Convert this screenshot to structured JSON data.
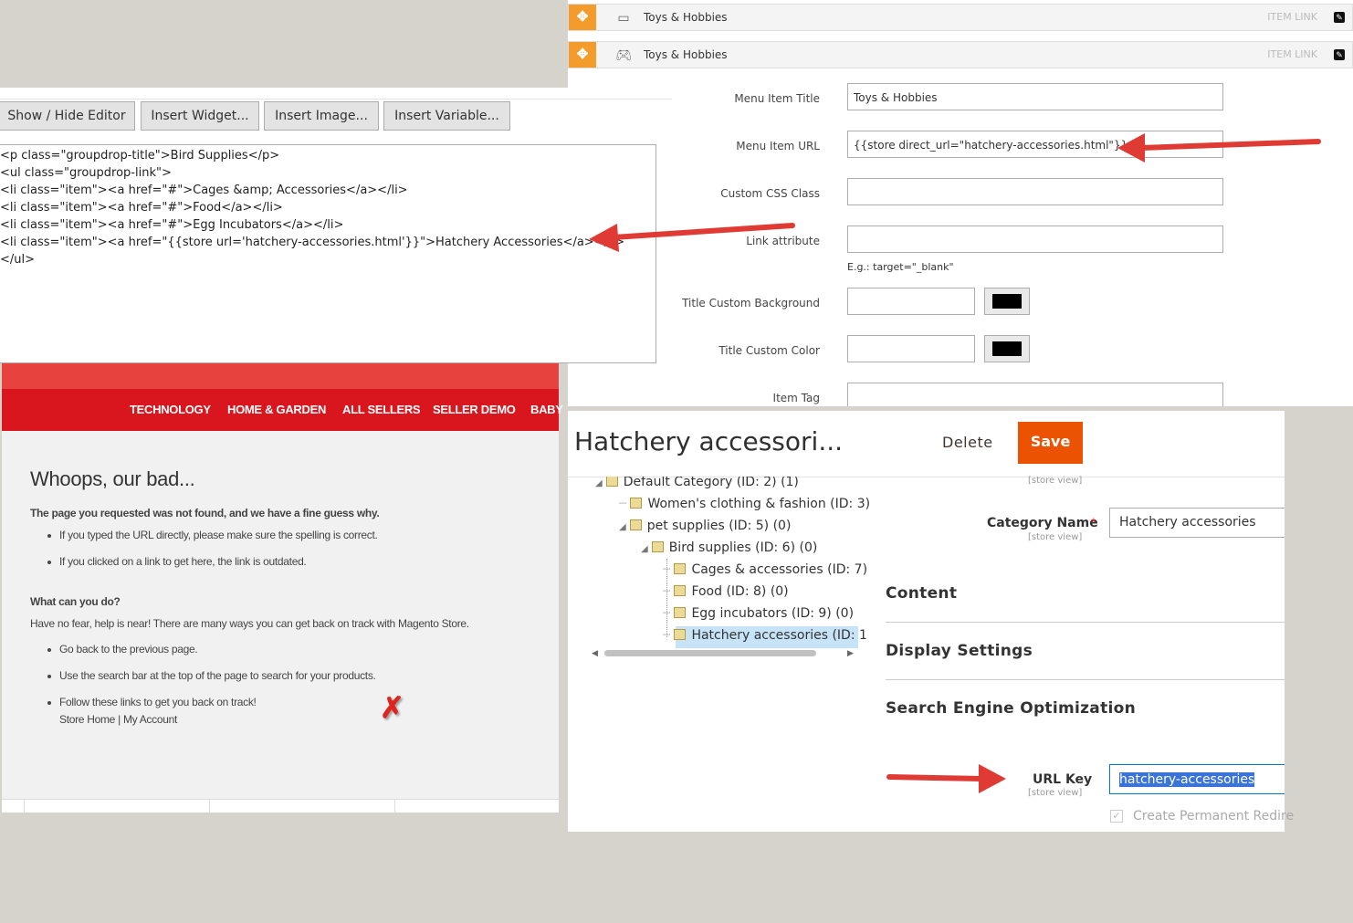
{
  "menu_panel": {
    "rows": [
      {
        "label": "Toys & Hobbies",
        "type": "ITEM LINK",
        "icon": "briefcase-icon"
      },
      {
        "label": "Toys & Hobbies",
        "type": "ITEM LINK",
        "icon": "gamepad-icon"
      }
    ],
    "fields": {
      "title_label": "Menu Item Title",
      "title_value": "Toys & Hobbies",
      "url_label": "Menu Item URL",
      "url_value": "{{store direct_url=\"hatchery-accessories.html\"}}",
      "css_label": "Custom CSS Class",
      "link_attr_label": "Link attribute",
      "link_attr_note": "E.g.: target=\"_blank\"",
      "title_bg_label": "Title Custom Background",
      "title_color_label": "Title Custom Color",
      "item_tag_label": "Item Tag"
    },
    "swatch_color": "#000000"
  },
  "editor": {
    "buttons": [
      "Show / Hide Editor",
      "Insert Widget...",
      "Insert Image...",
      "Insert Variable..."
    ],
    "code_lines": [
      "<p class=\"groupdrop-title\">Bird Supplies</p>",
      "<ul class=\"groupdrop-link\">",
      "<li class=\"item\"><a href=\"#\">Cages &amp; Accessories</a></li>",
      "<li class=\"item\"><a href=\"#\">Food</a></li>",
      "<li class=\"item\"><a href=\"#\">Egg Incubators</a></li>",
      "<li class=\"item\"><a href=\"{{store url='hatchery-accessories.html'}}\">Hatchery Accessories</a></li>",
      "</ul>"
    ]
  },
  "store_page": {
    "nav": [
      "TECHNOLOGY",
      "HOME & GARDEN",
      "ALL SELLERS",
      "SELLER DEMO",
      "BABY"
    ],
    "heading": "Whoops, our bad...",
    "subheading": "The page you requested was not found, and we have a fine guess why.",
    "reasons": [
      "If you typed the URL directly, please make sure the spelling is correct.",
      "If you clicked on a link to get here, the link is outdated."
    ],
    "what_heading": "What can you do?",
    "what_text": "Have no fear, help is near! There are many ways you can get back on track with Magento Store.",
    "actions": [
      "Go back to the previous page.",
      "Use the search bar at the top of the page to search for your products.",
      "Follow these links to get you back on track!"
    ],
    "link_store_home": "Store Home",
    "link_separator": "|",
    "link_my_account": "My Account",
    "nav_color": "#d9161e",
    "topbar_color": "#e8423f"
  },
  "category": {
    "title": "Hatchery accessori...",
    "delete_label": "Delete",
    "save_label": "Save",
    "save_color": "#eb5202",
    "tree": [
      {
        "label": "Default Category (ID: 2) (1)"
      },
      {
        "label": "Women's clothing & fashion (ID: 3)"
      },
      {
        "label": "pet supplies (ID: 5) (0)"
      },
      {
        "label": "Bird supplies (ID: 6) (0)"
      },
      {
        "label": "Cages & accessories (ID: 7)"
      },
      {
        "label": "Food (ID: 8) (0)"
      },
      {
        "label": "Egg incubators (ID: 9) (0)"
      },
      {
        "label": "Hatchery accessories (ID: 1"
      }
    ],
    "scope_label": "[store view]",
    "name_label": "Category Name",
    "required_mark": "*",
    "name_value": "Hatchery accessories",
    "sections": [
      "Content",
      "Display Settings",
      "Search Engine Optimization"
    ],
    "url_key_label": "URL Key",
    "url_key_value": "hatchery-accessories",
    "permanent_redirect_label": "Create Permanent Redire"
  },
  "annotations": {
    "arrow_color": "#e03a35",
    "error_mark_color": "#e0231c"
  }
}
